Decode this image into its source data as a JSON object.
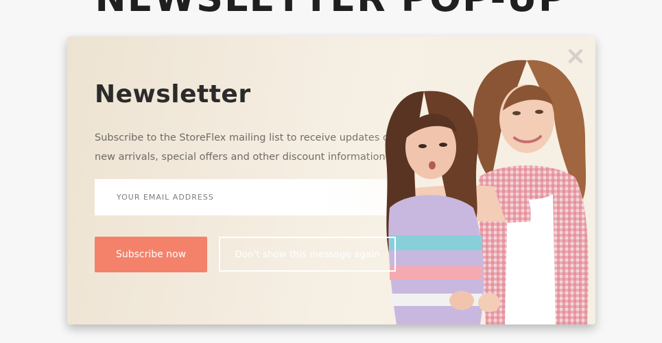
{
  "page": {
    "heading": "NEWSLETTER POP-UP"
  },
  "popup": {
    "title": "Newsletter",
    "description": "Subscribe to the StoreFlex mailing list to receive updates on new arrivals, special offers and other discount information.",
    "email_placeholder": "YOUR EMAIL ADDRESS",
    "email_value": "",
    "subscribe_label": "Subscribe now",
    "dismiss_label": "Don't show this message again",
    "close_icon": "close-icon",
    "photo_subject": "two-girls-photo"
  },
  "colors": {
    "accent": "#f4826b",
    "title": "#2b2b2b",
    "text": "#6f6a66",
    "page_background": "#f7f7f7",
    "popup_background": "#f3ebde"
  }
}
